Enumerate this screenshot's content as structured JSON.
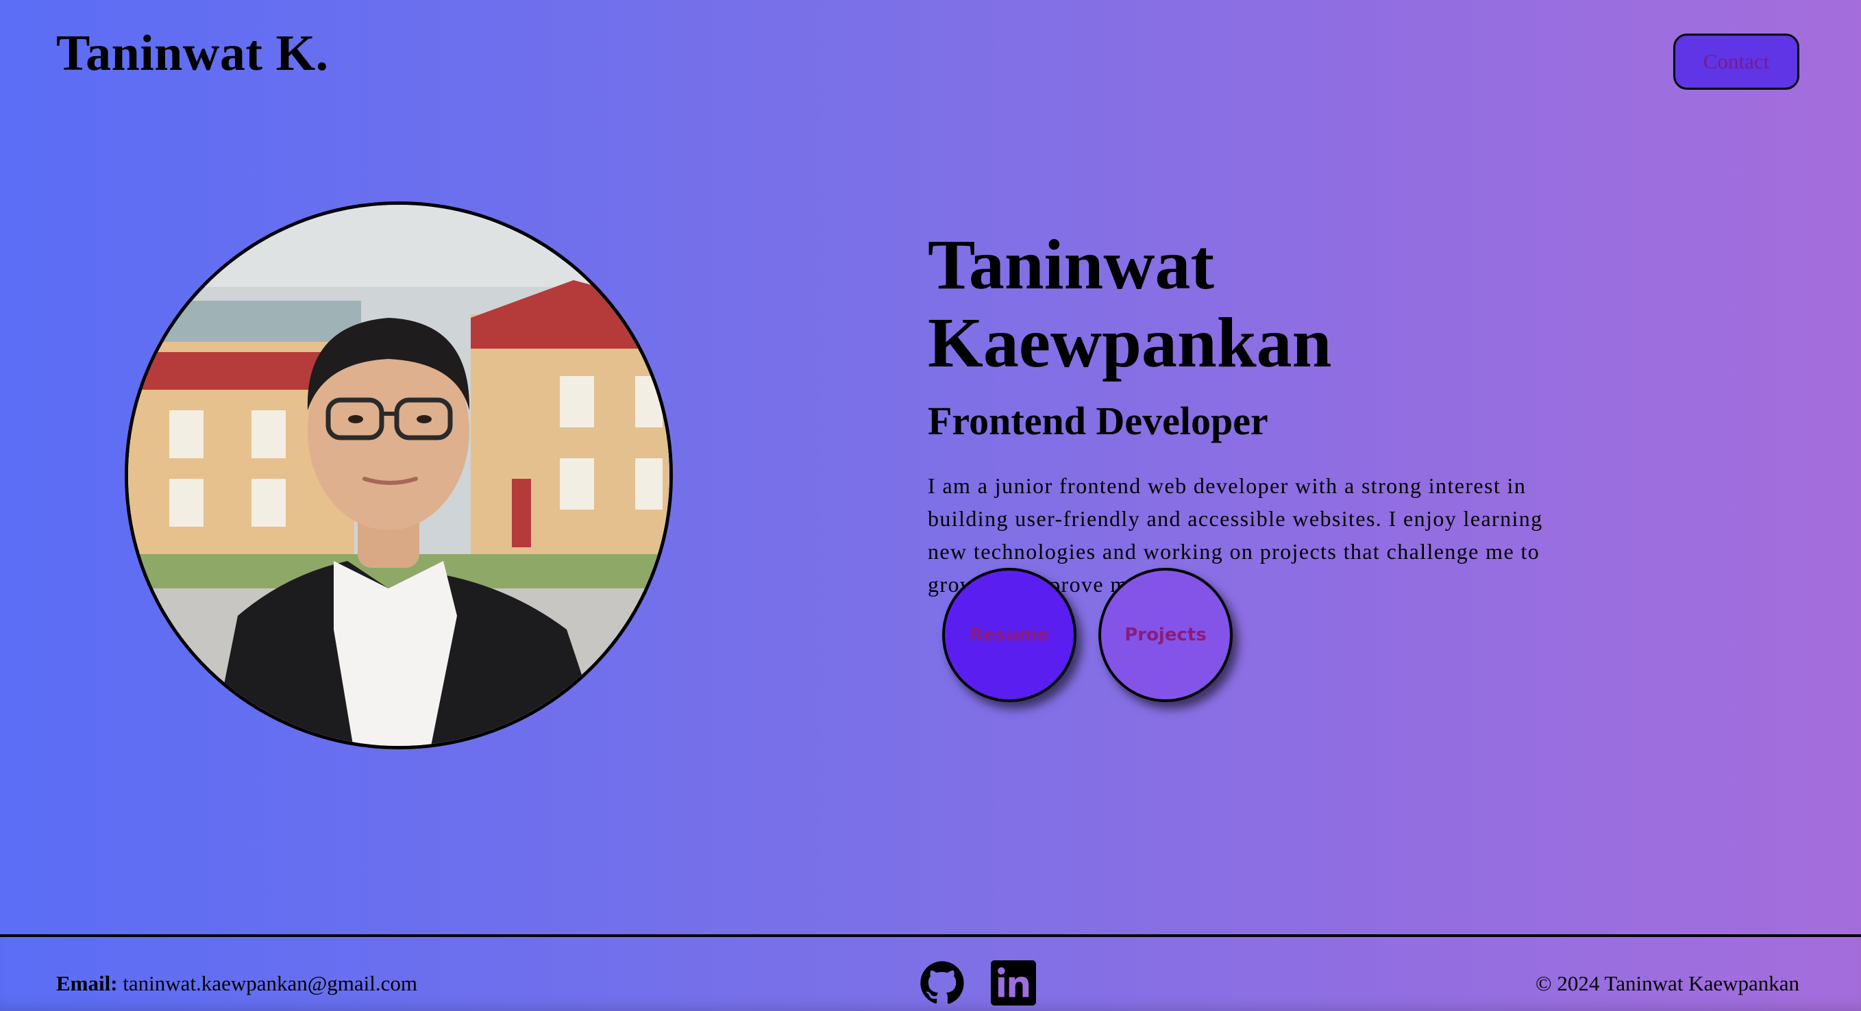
{
  "header": {
    "brand": "Taninwat K.",
    "contact_label": "Contact"
  },
  "hero": {
    "name": "Taninwat Kaewpankan",
    "role": "Frontend Developer",
    "bio": "I am a junior frontend web developer with a strong interest in building user-friendly and accessible websites. I enjoy learning new technologies and working on projects that challenge me to grow and improve my skills.",
    "buttons": {
      "resume": "Resume",
      "projects": "Projects"
    }
  },
  "footer": {
    "email_label": "Email:",
    "email_value": "taninwat.kaewpankan@gmail.com",
    "social": [
      "github-icon",
      "linkedin-icon"
    ],
    "copyright": "© 2024 Taninwat Kaewpankan"
  },
  "colors": {
    "gradient_start": "#5b6ef5",
    "gradient_end": "#a56ddc",
    "contact_button": "#5f35e6",
    "resume_button": "#5a1ff0",
    "projects_button": "#8454e8",
    "button_text": "#8a1c7c"
  }
}
